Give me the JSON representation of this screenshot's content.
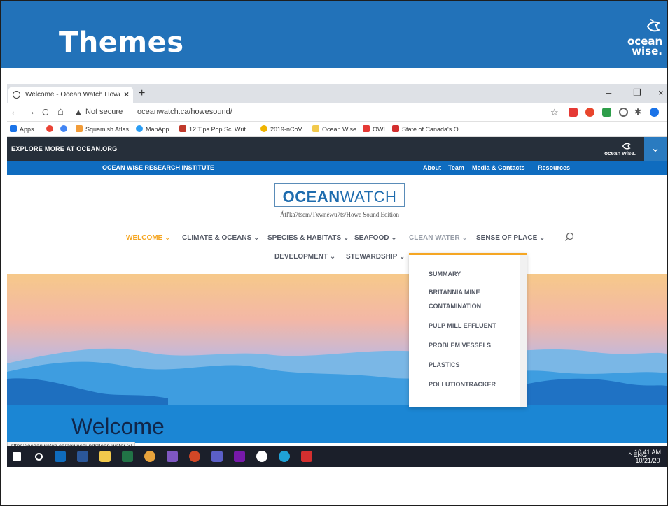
{
  "slide": {
    "title": "Themes",
    "logo_line1": "ocean",
    "logo_line2": "wise."
  },
  "browser": {
    "tab_title": "Welcome - Ocean Watch Howe S",
    "tab_close": "×",
    "new_tab": "+",
    "window_controls": [
      "–",
      "❐",
      "×"
    ],
    "nav": {
      "back": "←",
      "forward": "→",
      "reload": "C",
      "home": "⌂"
    },
    "not_secure": "Not secure",
    "url": "oceanwatch.ca/howesound/",
    "bookmarks": [
      {
        "label": "Apps",
        "color": "#1a73e8"
      },
      {
        "label": "",
        "color": "#ea4335"
      },
      {
        "label": "",
        "color": "#4285f4"
      },
      {
        "label": "Squamish Atlas",
        "color": "#f29c38"
      },
      {
        "label": "MapApp",
        "color": "#2a9df4"
      },
      {
        "label": "12 Tips Pop Sci Writ...",
        "color": "#c0392b"
      },
      {
        "label": "2019-nCoV",
        "color": "#f0b400"
      },
      {
        "label": "Ocean Wise",
        "color": "#f2c94c"
      },
      {
        "label": "OWL",
        "color": "#e53935"
      },
      {
        "label": "State of Canada's O...",
        "color": "#d32f2f"
      }
    ]
  },
  "site": {
    "explore": "EXPLORE MORE AT OCEAN.ORG",
    "explore_logo": "ocean wise.",
    "explore_chevron": "⌄",
    "research": "OCEAN WISE RESEARCH INSTITUTE",
    "research_links": [
      "About",
      "Team",
      "Media & Contacts",
      "Resources"
    ],
    "logo_bold": "OCEAN",
    "logo_light": "WATCH",
    "logo_sub": "Átl'ka7tsem/Txwnéwu7ts/Howe Sound Edition",
    "nav": [
      {
        "label": "WELCOME ⌄"
      },
      {
        "label": "CLIMATE & OCEANS ⌄"
      },
      {
        "label": "SPECIES & HABITATS ⌄"
      },
      {
        "label": "SEAFOOD ⌄"
      },
      {
        "label": "CLEAN WATER ⌄"
      },
      {
        "label": "SENSE OF PLACE ⌄"
      },
      {
        "label": "DEVELOPMENT ⌄"
      },
      {
        "label": "STEWARDSHIP ⌄"
      }
    ],
    "dropdown": [
      "SUMMARY",
      "BRITANNIA MINE",
      "CONTAMINATION",
      "PULP MILL EFFLUENT",
      "PROBLEM VESSELS",
      "PLASTICS",
      "POLLUTIONTRACKER"
    ],
    "welcome": "Welcome",
    "status_url": "https://oceanwatch.ca/howesound/clean-water-3/"
  },
  "taskbar": {
    "icons": [
      {
        "name": "windows-start-icon",
        "color": "#ffffff"
      },
      {
        "name": "search-circle-icon",
        "color": "#ffffff"
      },
      {
        "name": "outlook-icon",
        "color": "#0f6cbd"
      },
      {
        "name": "word-icon",
        "color": "#2b579a"
      },
      {
        "name": "file-explorer-icon",
        "color": "#f2c94c"
      },
      {
        "name": "excel-icon",
        "color": "#217346"
      },
      {
        "name": "chrome-icon",
        "color": "#e8a33c"
      },
      {
        "name": "snip-icon",
        "color": "#7e57c2"
      },
      {
        "name": "powerpoint-icon",
        "color": "#d24726"
      },
      {
        "name": "teams-icon",
        "color": "#5b5fc7"
      },
      {
        "name": "onenote-icon",
        "color": "#7719aa"
      },
      {
        "name": "browser-globe-icon",
        "color": "#ffffff"
      },
      {
        "name": "edge-icon",
        "color": "#1fa2d7"
      },
      {
        "name": "acrobat-icon",
        "color": "#d32f2f"
      }
    ],
    "tray": "^  ENG",
    "time": "10:41 AM",
    "date": "10/21/20"
  }
}
